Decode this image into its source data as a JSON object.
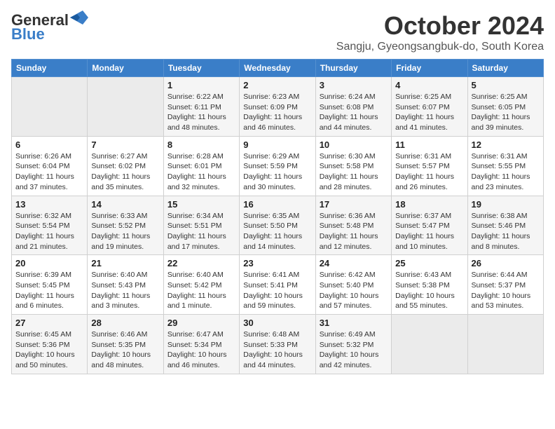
{
  "logo": {
    "line1": "General",
    "line2": "Blue"
  },
  "header": {
    "title": "October 2024",
    "subtitle": "Sangju, Gyeongsangbuk-do, South Korea"
  },
  "days": [
    "Sunday",
    "Monday",
    "Tuesday",
    "Wednesday",
    "Thursday",
    "Friday",
    "Saturday"
  ],
  "weeks": [
    [
      {
        "day": "",
        "info": ""
      },
      {
        "day": "",
        "info": ""
      },
      {
        "day": "1",
        "info": "Sunrise: 6:22 AM\nSunset: 6:11 PM\nDaylight: 11 hours\nand 48 minutes."
      },
      {
        "day": "2",
        "info": "Sunrise: 6:23 AM\nSunset: 6:09 PM\nDaylight: 11 hours\nand 46 minutes."
      },
      {
        "day": "3",
        "info": "Sunrise: 6:24 AM\nSunset: 6:08 PM\nDaylight: 11 hours\nand 44 minutes."
      },
      {
        "day": "4",
        "info": "Sunrise: 6:25 AM\nSunset: 6:07 PM\nDaylight: 11 hours\nand 41 minutes."
      },
      {
        "day": "5",
        "info": "Sunrise: 6:25 AM\nSunset: 6:05 PM\nDaylight: 11 hours\nand 39 minutes."
      }
    ],
    [
      {
        "day": "6",
        "info": "Sunrise: 6:26 AM\nSunset: 6:04 PM\nDaylight: 11 hours\nand 37 minutes."
      },
      {
        "day": "7",
        "info": "Sunrise: 6:27 AM\nSunset: 6:02 PM\nDaylight: 11 hours\nand 35 minutes."
      },
      {
        "day": "8",
        "info": "Sunrise: 6:28 AM\nSunset: 6:01 PM\nDaylight: 11 hours\nand 32 minutes."
      },
      {
        "day": "9",
        "info": "Sunrise: 6:29 AM\nSunset: 5:59 PM\nDaylight: 11 hours\nand 30 minutes."
      },
      {
        "day": "10",
        "info": "Sunrise: 6:30 AM\nSunset: 5:58 PM\nDaylight: 11 hours\nand 28 minutes."
      },
      {
        "day": "11",
        "info": "Sunrise: 6:31 AM\nSunset: 5:57 PM\nDaylight: 11 hours\nand 26 minutes."
      },
      {
        "day": "12",
        "info": "Sunrise: 6:31 AM\nSunset: 5:55 PM\nDaylight: 11 hours\nand 23 minutes."
      }
    ],
    [
      {
        "day": "13",
        "info": "Sunrise: 6:32 AM\nSunset: 5:54 PM\nDaylight: 11 hours\nand 21 minutes."
      },
      {
        "day": "14",
        "info": "Sunrise: 6:33 AM\nSunset: 5:52 PM\nDaylight: 11 hours\nand 19 minutes."
      },
      {
        "day": "15",
        "info": "Sunrise: 6:34 AM\nSunset: 5:51 PM\nDaylight: 11 hours\nand 17 minutes."
      },
      {
        "day": "16",
        "info": "Sunrise: 6:35 AM\nSunset: 5:50 PM\nDaylight: 11 hours\nand 14 minutes."
      },
      {
        "day": "17",
        "info": "Sunrise: 6:36 AM\nSunset: 5:48 PM\nDaylight: 11 hours\nand 12 minutes."
      },
      {
        "day": "18",
        "info": "Sunrise: 6:37 AM\nSunset: 5:47 PM\nDaylight: 11 hours\nand 10 minutes."
      },
      {
        "day": "19",
        "info": "Sunrise: 6:38 AM\nSunset: 5:46 PM\nDaylight: 11 hours\nand 8 minutes."
      }
    ],
    [
      {
        "day": "20",
        "info": "Sunrise: 6:39 AM\nSunset: 5:45 PM\nDaylight: 11 hours\nand 6 minutes."
      },
      {
        "day": "21",
        "info": "Sunrise: 6:40 AM\nSunset: 5:43 PM\nDaylight: 11 hours\nand 3 minutes."
      },
      {
        "day": "22",
        "info": "Sunrise: 6:40 AM\nSunset: 5:42 PM\nDaylight: 11 hours\nand 1 minute."
      },
      {
        "day": "23",
        "info": "Sunrise: 6:41 AM\nSunset: 5:41 PM\nDaylight: 10 hours\nand 59 minutes."
      },
      {
        "day": "24",
        "info": "Sunrise: 6:42 AM\nSunset: 5:40 PM\nDaylight: 10 hours\nand 57 minutes."
      },
      {
        "day": "25",
        "info": "Sunrise: 6:43 AM\nSunset: 5:38 PM\nDaylight: 10 hours\nand 55 minutes."
      },
      {
        "day": "26",
        "info": "Sunrise: 6:44 AM\nSunset: 5:37 PM\nDaylight: 10 hours\nand 53 minutes."
      }
    ],
    [
      {
        "day": "27",
        "info": "Sunrise: 6:45 AM\nSunset: 5:36 PM\nDaylight: 10 hours\nand 50 minutes."
      },
      {
        "day": "28",
        "info": "Sunrise: 6:46 AM\nSunset: 5:35 PM\nDaylight: 10 hours\nand 48 minutes."
      },
      {
        "day": "29",
        "info": "Sunrise: 6:47 AM\nSunset: 5:34 PM\nDaylight: 10 hours\nand 46 minutes."
      },
      {
        "day": "30",
        "info": "Sunrise: 6:48 AM\nSunset: 5:33 PM\nDaylight: 10 hours\nand 44 minutes."
      },
      {
        "day": "31",
        "info": "Sunrise: 6:49 AM\nSunset: 5:32 PM\nDaylight: 10 hours\nand 42 minutes."
      },
      {
        "day": "",
        "info": ""
      },
      {
        "day": "",
        "info": ""
      }
    ]
  ]
}
